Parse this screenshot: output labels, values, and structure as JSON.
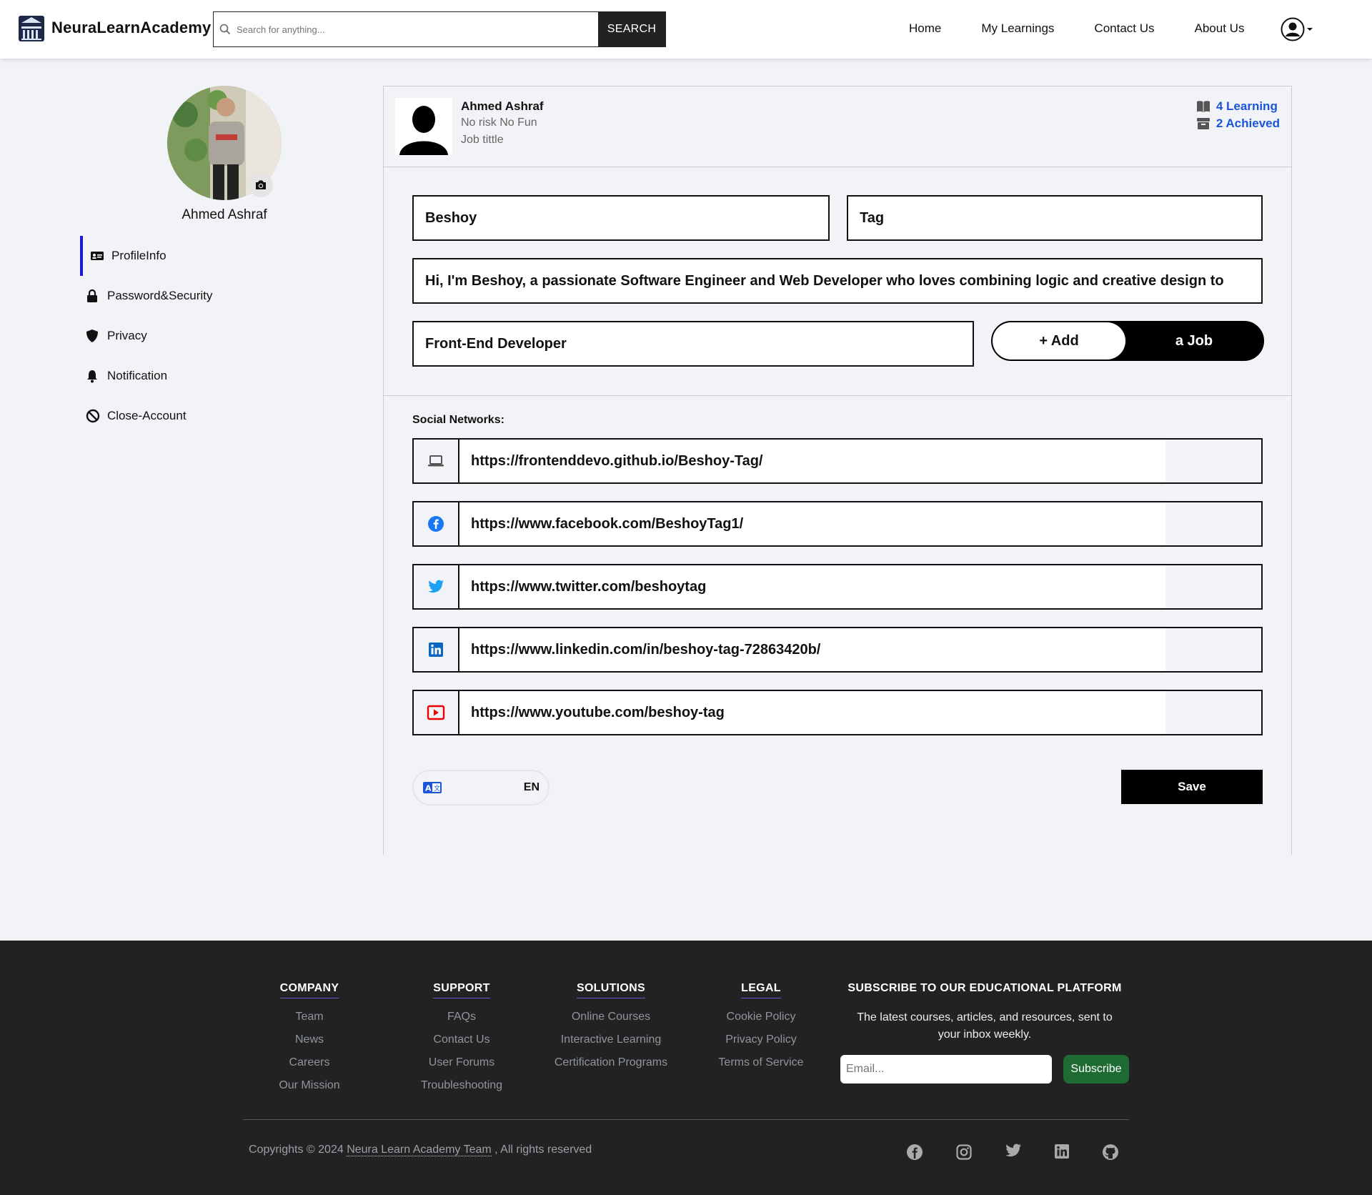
{
  "brand": {
    "name": "NeuraLearnAcademy"
  },
  "search": {
    "placeholder": "Search for anything...",
    "button": "SEARCH"
  },
  "nav": {
    "links": [
      "Home",
      "My Learnings",
      "Contact Us",
      "About Us"
    ]
  },
  "sidebar": {
    "name": "Ahmed Ashraf",
    "items": [
      {
        "label": "ProfileInfo",
        "icon": "id-card-icon",
        "active": true
      },
      {
        "label": "Password&Security",
        "icon": "lock-icon"
      },
      {
        "label": "Privacy",
        "icon": "shield-icon"
      },
      {
        "label": "Notification",
        "icon": "bell-icon"
      },
      {
        "label": "Close-Account",
        "icon": "ban-icon"
      }
    ]
  },
  "profile_header": {
    "name": "Ahmed Ashraf",
    "subtitle": "No risk No Fun",
    "job": "Job tittle",
    "stats": {
      "learning": "4 Learning",
      "achieved": "2 Achieved"
    }
  },
  "form": {
    "first_name": "Beshoy",
    "last_name": "Tag",
    "bio": "Hi, I'm Beshoy, a passionate Software Engineer and Web Developer who loves combining logic and creative design to",
    "job_title": "Front-End Developer",
    "toggle_add": "+ Add",
    "toggle_job": "a Job",
    "social_label": "Social Networks:",
    "socials": [
      {
        "icon": "laptop-icon",
        "url": "https://frontenddevo.github.io/Beshoy-Tag/"
      },
      {
        "icon": "facebook-icon",
        "url": "https://www.facebook.com/BeshoyTag1/"
      },
      {
        "icon": "twitter-icon",
        "url": "https://www.twitter.com/beshoytag"
      },
      {
        "icon": "linkedin-icon",
        "url": "https://www.linkedin.com/in/beshoy-tag-72863420b/"
      },
      {
        "icon": "youtube-icon",
        "url": "https://www.youtube.com/beshoy-tag"
      }
    ],
    "language": "EN",
    "save": "Save"
  },
  "footer": {
    "columns": [
      {
        "title": "COMPANY",
        "links": [
          "Team",
          "News",
          "Careers",
          "Our Mission"
        ]
      },
      {
        "title": "SUPPORT",
        "links": [
          "FAQs",
          "Contact Us",
          "User Forums",
          "Troubleshooting"
        ]
      },
      {
        "title": "SOLUTIONS",
        "links": [
          "Online Courses",
          "Interactive Learning",
          "Certification Programs"
        ]
      },
      {
        "title": "LEGAL",
        "links": [
          "Cookie Policy",
          "Privacy Policy",
          "Terms of Service"
        ]
      }
    ],
    "subscribe": {
      "title": "SUBSCRIBE TO OUR EDUCATIONAL PLATFORM",
      "text": "The latest courses, articles, and resources, sent to your inbox weekly.",
      "placeholder": "Email...",
      "button": "Subscribe"
    },
    "copyright_prefix": "Copyrights © 2024",
    "copyright_team": "Neura Learn Academy Team",
    "copyright_suffix": ", All rights reserved"
  },
  "colors": {
    "accent": "#1a55d9",
    "active_bar": "#1a1ad4",
    "subscribe": "#1e6b33",
    "footer_bg": "#222222"
  }
}
